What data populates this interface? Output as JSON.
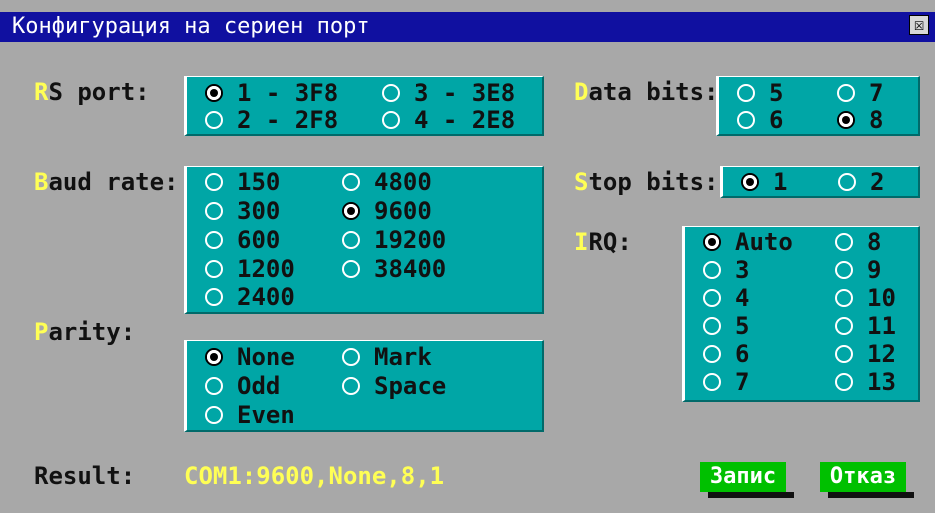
{
  "window": {
    "title": "Конфигурация на сериен порт",
    "close_glyph": "☒"
  },
  "rs_port": {
    "hotkey": "R",
    "label_rest": "S port:",
    "options": [
      {
        "label": "1 - 3F8",
        "selected": true
      },
      {
        "label": "3 - 3E8",
        "selected": false
      },
      {
        "label": "2 - 2F8",
        "selected": false
      },
      {
        "label": "4 - 2E8",
        "selected": false
      }
    ]
  },
  "data_bits": {
    "hotkey": "D",
    "label_rest": "ata bits:",
    "options": [
      {
        "label": "5",
        "selected": false
      },
      {
        "label": "7",
        "selected": false
      },
      {
        "label": "6",
        "selected": false
      },
      {
        "label": "8",
        "selected": true
      }
    ]
  },
  "baud_rate": {
    "hotkey": "B",
    "label_rest": "aud rate:",
    "options": [
      {
        "label": "150",
        "selected": false
      },
      {
        "label": "4800",
        "selected": false
      },
      {
        "label": "300",
        "selected": false
      },
      {
        "label": "9600",
        "selected": true
      },
      {
        "label": "600",
        "selected": false
      },
      {
        "label": "19200",
        "selected": false
      },
      {
        "label": "1200",
        "selected": false
      },
      {
        "label": "38400",
        "selected": false
      },
      {
        "label": "2400",
        "selected": false
      }
    ]
  },
  "stop_bits": {
    "hotkey": "S",
    "label_rest": "top bits:",
    "options": [
      {
        "label": "1",
        "selected": true
      },
      {
        "label": "2",
        "selected": false
      }
    ]
  },
  "irq": {
    "hotkey": "I",
    "label_rest": "RQ:",
    "options": [
      {
        "label": "Auto",
        "selected": true
      },
      {
        "label": "8",
        "selected": false
      },
      {
        "label": "3",
        "selected": false
      },
      {
        "label": "9",
        "selected": false
      },
      {
        "label": "4",
        "selected": false
      },
      {
        "label": "10",
        "selected": false
      },
      {
        "label": "5",
        "selected": false
      },
      {
        "label": "11",
        "selected": false
      },
      {
        "label": "6",
        "selected": false
      },
      {
        "label": "12",
        "selected": false
      },
      {
        "label": "7",
        "selected": false
      },
      {
        "label": "13",
        "selected": false
      }
    ]
  },
  "parity": {
    "hotkey": "P",
    "label_rest": "arity:",
    "options": [
      {
        "label": "None",
        "selected": true
      },
      {
        "label": "Mark",
        "selected": false
      },
      {
        "label": "Odd",
        "selected": false
      },
      {
        "label": "Space",
        "selected": false
      },
      {
        "label": "Even",
        "selected": false
      }
    ]
  },
  "result": {
    "label": "Result:",
    "value": "COM1:9600,None,8,1"
  },
  "buttons": {
    "save": "Запис",
    "cancel": "Отказ"
  },
  "colors": {
    "title_bar": "#1010a0",
    "panel": "#00a6a6",
    "background": "#a8a8a8",
    "hotkey": "#ffff55",
    "button": "#00c000"
  }
}
